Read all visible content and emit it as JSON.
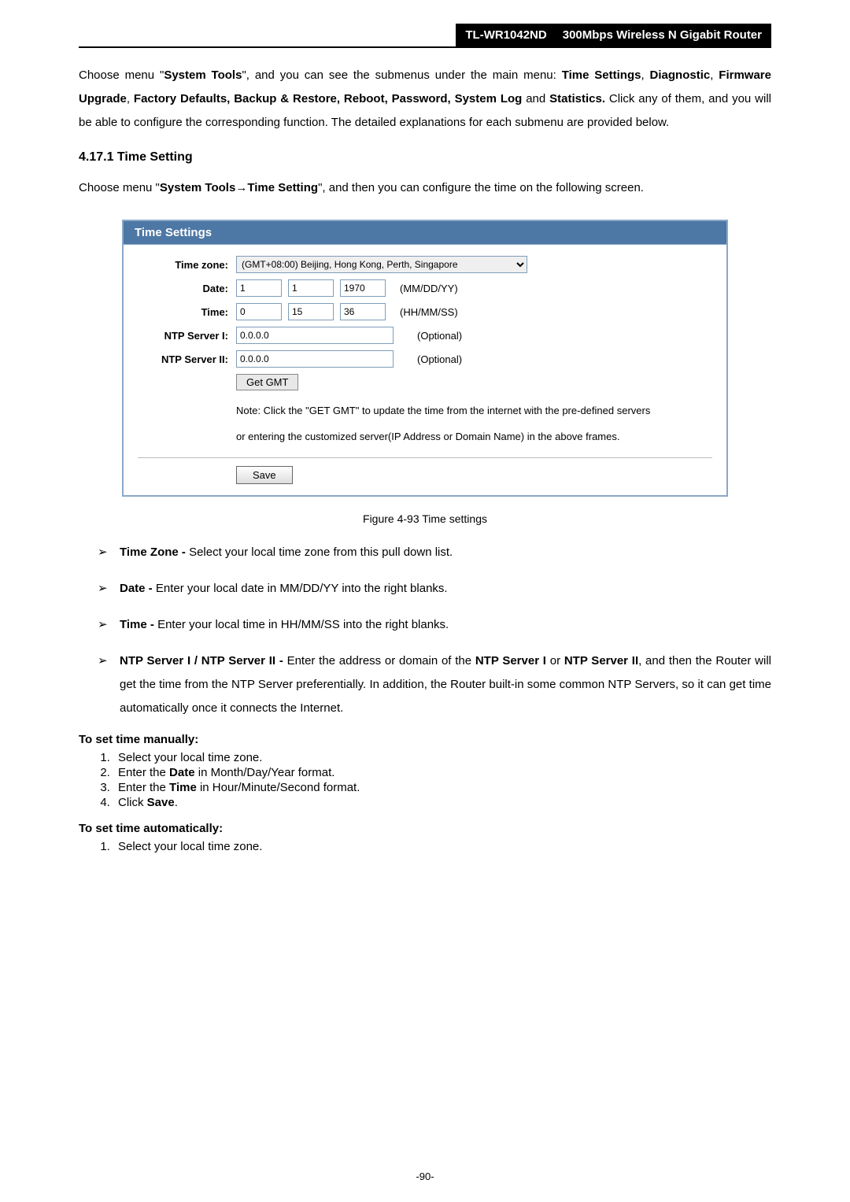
{
  "header": {
    "model": "TL-WR1042ND",
    "title": "300Mbps Wireless N Gigabit Router"
  },
  "intro_parts": {
    "p1a": "Choose menu \"",
    "p1_bold1": "System Tools",
    "p1b": "\", and you can see the submenus under the main menu: ",
    "p1_bold2": "Time Settings",
    "p1c": ", ",
    "p1_bold3": "Diagnostic",
    "p1d": ", ",
    "p1_bold4": "Firmware Upgrade",
    "p1e": ", ",
    "p1_bold5": "Factory Defaults, Backup & Restore, Reboot, Password, System Log",
    "p1f": " and ",
    "p1_bold6": "Statistics.",
    "p1g": " Click any of them, and you will be able to configure the corresponding function. The detailed explanations for each submenu are provided below."
  },
  "sec_heading": "4.17.1  Time Setting",
  "sec_intro": {
    "a": "Choose menu \"",
    "b1": "System Tools",
    "arrow": "→",
    "b2": "Time Setting",
    "c": "\", and then you can configure the time on the following screen."
  },
  "panel": {
    "title": "Time Settings",
    "labels": {
      "timezone": "Time zone:",
      "date": "Date:",
      "time": "Time:",
      "ntp1": "NTP Server I:",
      "ntp2": "NTP Server II:"
    },
    "values": {
      "timezone": "(GMT+08:00) Beijing, Hong Kong, Perth, Singapore",
      "date_m": "1",
      "date_d": "1",
      "date_y": "1970",
      "date_note": "(MM/DD/YY)",
      "time_h": "0",
      "time_m": "15",
      "time_s": "36",
      "time_note": "(HH/MM/SS)",
      "ntp1": "0.0.0.0",
      "ntp1_note": "(Optional)",
      "ntp2": "0.0.0.0",
      "ntp2_note": "(Optional)"
    },
    "get_gmt": "Get GMT",
    "note1": "Note: Click the \"GET GMT\" to update the time from the internet with the pre-defined servers",
    "note2": "or entering the customized server(IP Address or Domain Name) in the above frames.",
    "save": "Save"
  },
  "caption": "Figure 4-93    Time settings",
  "bullets": {
    "timezone": {
      "bold": "Time Zone - ",
      "rest": "Select your local time zone from this pull down list."
    },
    "date": {
      "bold": "Date - ",
      "rest": "Enter your local date in MM/DD/YY into the right blanks."
    },
    "time": {
      "bold": "Time - ",
      "rest": "Enter your local time in HH/MM/SS into the right blanks."
    },
    "ntp": {
      "bold": "NTP Server I / NTP Server II - ",
      "rest1": "Enter the address or domain of the ",
      "bold2": "NTP Server I",
      "rest2": " or ",
      "bold3": "NTP Server II",
      "rest3": ", and then the Router will get the time from the NTP Server preferentially. In addition, the Router built-in some common NTP Servers, so it can get time automatically once it connects the Internet."
    }
  },
  "manual_heading": "To set time manually:",
  "manual_steps": {
    "s1": "Select your local time zone.",
    "s2a": "Enter the ",
    "s2b": "Date",
    "s2c": " in Month/Day/Year format.",
    "s3a": "Enter the ",
    "s3b": "Time",
    "s3c": " in Hour/Minute/Second format.",
    "s4a": "Click ",
    "s4b": "Save",
    "s4c": "."
  },
  "auto_heading": "To set time automatically:",
  "auto_steps": {
    "s1": "Select your local time zone."
  },
  "page_number": "-90-"
}
